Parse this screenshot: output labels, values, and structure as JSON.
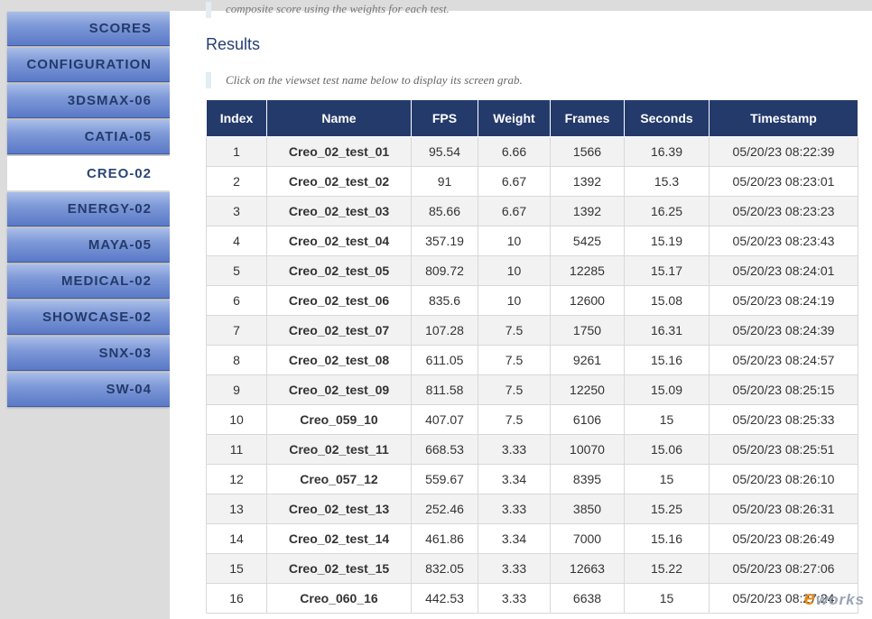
{
  "sidebar": {
    "items": [
      {
        "label": "SCORES",
        "active": false
      },
      {
        "label": "CONFIGURATION",
        "active": false
      },
      {
        "label": "3DSMAX-06",
        "active": false
      },
      {
        "label": "CATIA-05",
        "active": false
      },
      {
        "label": "CREO-02",
        "active": true
      },
      {
        "label": "ENERGY-02",
        "active": false
      },
      {
        "label": "MAYA-05",
        "active": false
      },
      {
        "label": "MEDICAL-02",
        "active": false
      },
      {
        "label": "SHOWCASE-02",
        "active": false
      },
      {
        "label": "SNX-03",
        "active": false
      },
      {
        "label": "SW-04",
        "active": false
      }
    ]
  },
  "main": {
    "top_note": "composite score using the weights for each test.",
    "results_title": "Results",
    "hint": "Click on the viewset test name below to display its screen grab."
  },
  "table": {
    "headers": [
      "Index",
      "Name",
      "FPS",
      "Weight",
      "Frames",
      "Seconds",
      "Timestamp"
    ],
    "rows": [
      [
        "1",
        "Creo_02_test_01",
        "95.54",
        "6.66",
        "1566",
        "16.39",
        "05/20/23 08:22:39"
      ],
      [
        "2",
        "Creo_02_test_02",
        "91",
        "6.67",
        "1392",
        "15.3",
        "05/20/23 08:23:01"
      ],
      [
        "3",
        "Creo_02_test_03",
        "85.66",
        "6.67",
        "1392",
        "16.25",
        "05/20/23 08:23:23"
      ],
      [
        "4",
        "Creo_02_test_04",
        "357.19",
        "10",
        "5425",
        "15.19",
        "05/20/23 08:23:43"
      ],
      [
        "5",
        "Creo_02_test_05",
        "809.72",
        "10",
        "12285",
        "15.17",
        "05/20/23 08:24:01"
      ],
      [
        "6",
        "Creo_02_test_06",
        "835.6",
        "10",
        "12600",
        "15.08",
        "05/20/23 08:24:19"
      ],
      [
        "7",
        "Creo_02_test_07",
        "107.28",
        "7.5",
        "1750",
        "16.31",
        "05/20/23 08:24:39"
      ],
      [
        "8",
        "Creo_02_test_08",
        "611.05",
        "7.5",
        "9261",
        "15.16",
        "05/20/23 08:24:57"
      ],
      [
        "9",
        "Creo_02_test_09",
        "811.58",
        "7.5",
        "12250",
        "15.09",
        "05/20/23 08:25:15"
      ],
      [
        "10",
        "Creo_059_10",
        "407.07",
        "7.5",
        "6106",
        "15",
        "05/20/23 08:25:33"
      ],
      [
        "11",
        "Creo_02_test_11",
        "668.53",
        "3.33",
        "10070",
        "15.06",
        "05/20/23 08:25:51"
      ],
      [
        "12",
        "Creo_057_12",
        "559.67",
        "3.34",
        "8395",
        "15",
        "05/20/23 08:26:10"
      ],
      [
        "13",
        "Creo_02_test_13",
        "252.46",
        "3.33",
        "3850",
        "15.25",
        "05/20/23 08:26:31"
      ],
      [
        "14",
        "Creo_02_test_14",
        "461.86",
        "3.34",
        "7000",
        "15.16",
        "05/20/23 08:26:49"
      ],
      [
        "15",
        "Creo_02_test_15",
        "832.05",
        "3.33",
        "12663",
        "15.22",
        "05/20/23 08:27:06"
      ],
      [
        "16",
        "Creo_060_16",
        "442.53",
        "3.33",
        "6638",
        "15",
        "05/20/23 08:27:24"
      ]
    ]
  },
  "watermark": {
    "first": "e",
    "rest": "works"
  },
  "colors": {
    "nav_blue": "#5a79c7",
    "header_navy": "#243a6b",
    "title": "#253f73"
  }
}
